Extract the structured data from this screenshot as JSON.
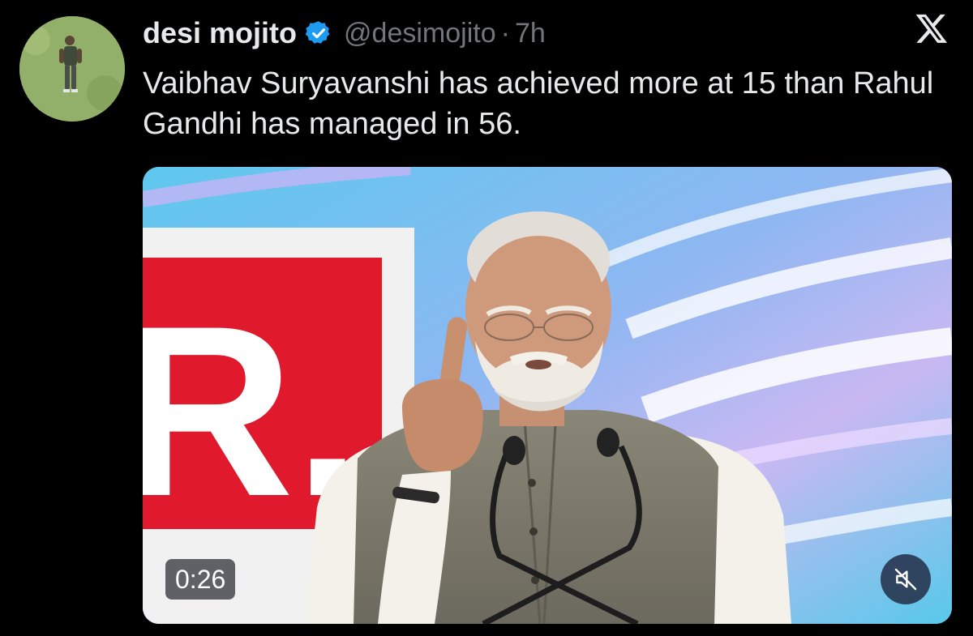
{
  "tweet": {
    "author_name": "desi mojito",
    "handle": "@desimojito",
    "separator": "·",
    "time": "7h",
    "text": "Vaibhav Suryavanshi has achieved more at 15 than Rahul Gandhi has managed in 56.",
    "verified": true
  },
  "media": {
    "type": "video",
    "duration": "0:26",
    "muted": true,
    "logo_letter": "R."
  },
  "icons": {
    "avatar": "avatar-photo",
    "verified": "verified-badge-icon",
    "platform": "x-logo-icon",
    "mute": "mute-icon"
  },
  "colors": {
    "background": "#000000",
    "text": "#e7e9ea",
    "secondary": "#71767b",
    "verified": "#1d9bf0"
  }
}
